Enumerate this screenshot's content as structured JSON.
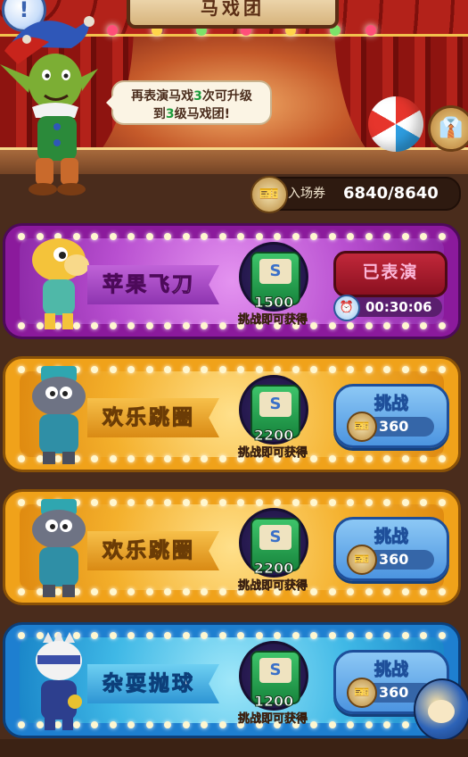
{
  "header": {
    "title": "马戏团",
    "alert_glyph": "!",
    "speech_parts": [
      "再表演马戏",
      "3",
      "次可升级",
      "到",
      "3",
      "级马戏团!"
    ]
  },
  "ticket": {
    "label": "入场券",
    "count": "6840/8640"
  },
  "acts": [
    {
      "name": "苹果飞刀",
      "theme": "purple",
      "character": "yellow-horse",
      "reward_amount": "1500",
      "reward_caption": "挑战即可获得",
      "status": "performed",
      "status_label": "已表演",
      "timer": "00:30:06"
    },
    {
      "name": "欢乐跳圈",
      "theme": "yellow",
      "character": "grey-rhino-ringmaster",
      "reward_amount": "2200",
      "reward_caption": "挑战即可获得",
      "status": "available",
      "button_label": "挑战",
      "cost": "360"
    },
    {
      "name": "欢乐跳圈",
      "theme": "yellow",
      "character": "grey-rhino-ringmaster",
      "reward_amount": "2200",
      "reward_caption": "挑战即可获得",
      "status": "available",
      "button_label": "挑战",
      "cost": "360"
    },
    {
      "name": "杂耍抛球",
      "theme": "blue",
      "character": "masked-juggler",
      "reward_amount": "1200",
      "reward_caption": "挑战即可获得",
      "status": "available",
      "button_label": "挑战",
      "cost": "360"
    }
  ],
  "colors": {
    "purple": "#8b1a9c",
    "yellow": "#f0a21a",
    "blue": "#1e7fd0",
    "highlight_green": "#1e9b3c"
  },
  "icons": {
    "alert": "exclamation-icon",
    "ticket": "ticket-icon",
    "reward": "scroll-icon",
    "timer": "clock-icon",
    "side": "costume-icon"
  }
}
